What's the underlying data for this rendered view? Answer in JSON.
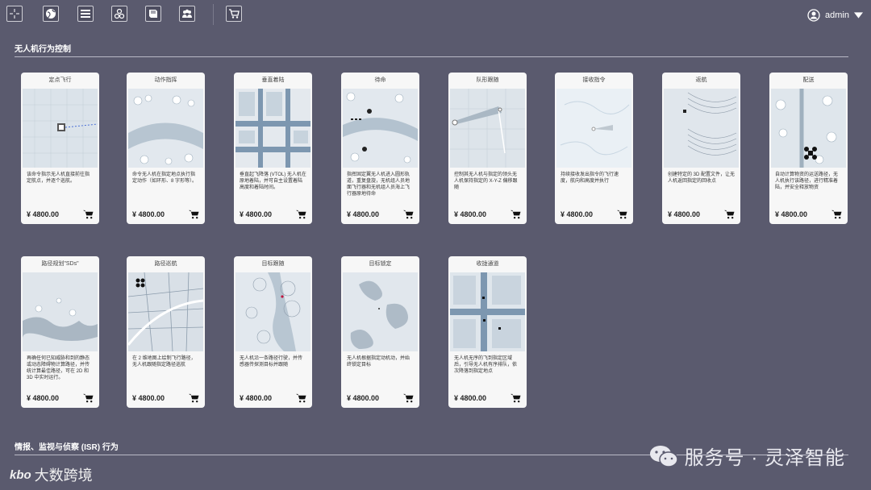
{
  "toolbar": {
    "buttons": [
      {
        "name": "crosshair-icon"
      },
      {
        "name": "globe-icon"
      },
      {
        "name": "list-icon"
      },
      {
        "name": "group-icon"
      },
      {
        "name": "book-icon"
      },
      {
        "name": "people-icon"
      },
      {
        "name": "cart-icon"
      }
    ]
  },
  "user": {
    "name": "admin"
  },
  "sections": [
    {
      "title": "无人机行为控制"
    },
    {
      "title": "情报、监视与侦察 (ISR) 行为"
    }
  ],
  "cards": [
    {
      "title": "定点飞行",
      "desc": "该命令指示无人机直接前往指定航点，并逐个巡航。",
      "price": "¥ 4800.00"
    },
    {
      "title": "动作指挥",
      "desc": "命令无人机在指定地点执行指定动作（如环形、8 字形等）。",
      "price": "¥ 4800.00"
    },
    {
      "title": "垂直着陆",
      "desc": "垂直起飞降落 (VTOL) 无人机在原地着陆，并可自主设置着陆高度和着陆时间。",
      "price": "¥ 4800.00"
    },
    {
      "title": "待命",
      "desc": "指挥固定翼无人机进入圆形轨道，重复盘旋，无机组人员地面飞行器和无机组人员海上飞行器原地待命",
      "price": "¥ 4800.00"
    },
    {
      "title": "队形跟随",
      "desc": "控制其无人机与指定的领头无人机保持指定的 X-Y-Z 偏移跟随",
      "price": "¥ 4800.00"
    },
    {
      "title": "接收指令",
      "desc": "持续接收发出指令的飞行速度，航向和高度并执行",
      "price": "¥ 4800.00"
    },
    {
      "title": "返航",
      "desc": "创建特定的 3D 配置文件，让无人机返回指定的回收点",
      "price": "¥ 4800.00"
    },
    {
      "title": "配送",
      "desc": "自动计算物资的运送路径，无人机执行该路径，进行精准着陆，并安全释放物资",
      "price": "¥ 4800.00"
    },
    {
      "title": "路径规划\"SDs\"",
      "desc": "再确任何已知威胁和到的静态或动态障碍物计算路径，并传统计算最佳路径，可在 2D 和 3D 中实时运行。",
      "price": "¥ 4800.00"
    },
    {
      "title": "路径巡航",
      "desc": "在 2 维地图上绘制飞行路径，无人机跟随指定路径巡航",
      "price": "¥ 4800.00"
    },
    {
      "title": "目标跟随",
      "desc": "无人机沿一条路径行驶，并传感器传探测目标并跟随",
      "price": "¥ 4800.00"
    },
    {
      "title": "目标锁定",
      "desc": "无人机根据指定动机动，并始终锁定目标",
      "price": "¥ 4800.00"
    },
    {
      "title": "收拢通道",
      "desc": "无人机无序的飞到指定区域后，引导无人机有序排队，依次降落到指定地点",
      "price": "¥ 4800.00"
    }
  ],
  "watermarks": {
    "right": "服务号 · 灵泽智能",
    "left_logo": "kbo",
    "left_text": "大数跨境"
  },
  "colors": {
    "background": "#5a5a6e",
    "card": "#f7f7f7",
    "accent": "#1a1a1a"
  }
}
